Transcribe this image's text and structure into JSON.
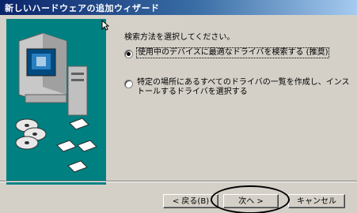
{
  "window": {
    "title": "新しいハードウェアの追加ウィザード"
  },
  "content": {
    "instruction": "検索方法を選択してください。",
    "options": [
      {
        "label": "使用中のデバイスに最適なドライバを検索する (推奨)",
        "selected": true
      },
      {
        "label_line1": "特定の場所にあるすべてのドライバの一覧を作成し、インス",
        "label_line2": "トールするドライバを選択する",
        "selected": false
      }
    ]
  },
  "buttons": {
    "back": "< 戻る(B)",
    "next": "次へ >",
    "cancel": "キャンセル"
  },
  "colors": {
    "title_start": "#0a246a",
    "title_end": "#a6caf0",
    "dialog_bg": "#d4d0c8",
    "art_bg": "#008080",
    "highlight_circle": "#000000"
  },
  "icons": [
    "computer-monitor-icon",
    "disc-icon",
    "floppy-disk-icon",
    "mouse-cursor-icon"
  ]
}
